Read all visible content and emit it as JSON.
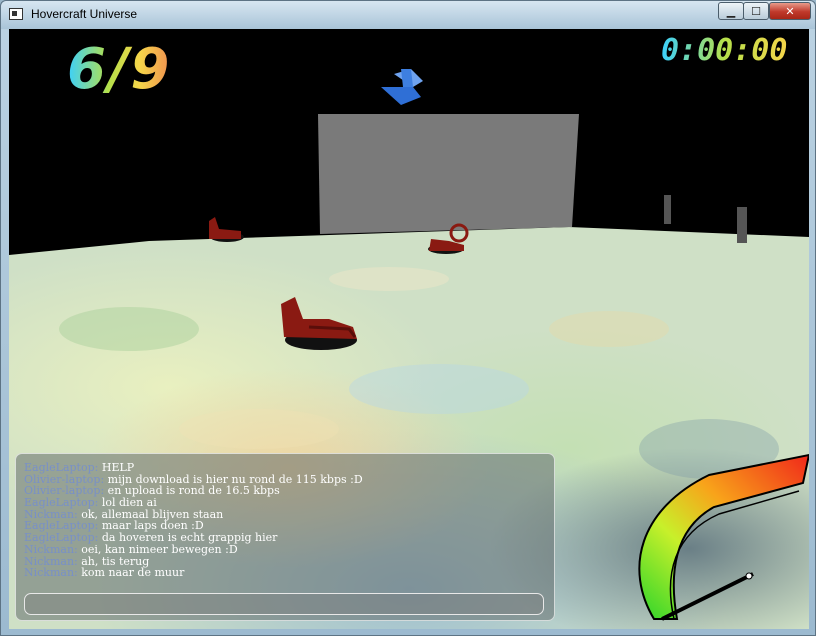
{
  "window": {
    "title": "Hovercraft Universe",
    "minimize_label": "▁",
    "maximize_label": "☐",
    "close_label": "✕"
  },
  "hud": {
    "laps": "6/9",
    "timer": "0:00:00",
    "speed_fraction": 0.0
  },
  "colors": {
    "sky": "#000000",
    "wall": "#7a7a7a",
    "hovercraft": "#8a1a12",
    "checkpoint_arrow": "#3e7fe0",
    "nick": "#7890c8"
  },
  "chat": {
    "messages": [
      {
        "nick": "EagleLaptop:",
        "text": "HELP"
      },
      {
        "nick": "Olivier-laptop:",
        "text": "mijn download is hier nu rond de 115 kbps :D"
      },
      {
        "nick": "Olivier-laptop:",
        "text": "en upload is rond de 16.5 kbps"
      },
      {
        "nick": "EagleLaptop:",
        "text": "lol dien ai"
      },
      {
        "nick": "Nickman:",
        "text": "ok, allemaal blijven staan"
      },
      {
        "nick": "EagleLaptop:",
        "text": "maar laps doen :D"
      },
      {
        "nick": "EagleLaptop:",
        "text": "da hoveren is echt grappig hier"
      },
      {
        "nick": "Nickman:",
        "text": "oei, kan nimeer bewegen :D"
      },
      {
        "nick": "Nickman:",
        "text": "ah, tis terug"
      },
      {
        "nick": "Nickman:",
        "text": "kom naar de muur"
      }
    ],
    "input_value": ""
  }
}
